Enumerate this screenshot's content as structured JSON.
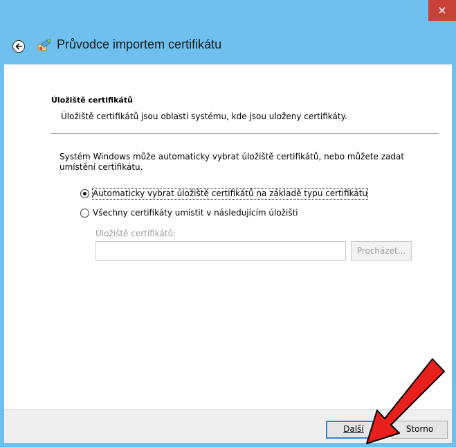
{
  "window": {
    "title": "Průvodce importem certifikátu",
    "close_glyph": "×"
  },
  "section": {
    "title": "Úložiště certifikátů",
    "description": "Úložiště certifikátů jsou oblasti systému, kde jsou uloženy certifikáty."
  },
  "intro_text": "Systém Windows může automaticky vybrat úložiště certifikátů, nebo můžete zadat umístění certifikátu.",
  "options": [
    {
      "label": "Automaticky vybrat úložiště certifikátů na základě typu certifikátu",
      "selected": true
    },
    {
      "label": "Všechny certifikáty umístit v následujícím úložišti",
      "selected": false
    }
  ],
  "store_field": {
    "label": "Úložiště certifikátů:",
    "value": ""
  },
  "browse_button": "Procházet...",
  "buttons": {
    "next": "Další",
    "cancel": "Storno"
  },
  "colors": {
    "titlebar": "#6fc0ee",
    "close": "#c9423a",
    "default_button_border": "#2f86d6",
    "arrow": "#e8201c"
  },
  "icons": {
    "back": "back-arrow-icon",
    "wizard": "certificate-wizard-icon",
    "close": "close-icon"
  }
}
